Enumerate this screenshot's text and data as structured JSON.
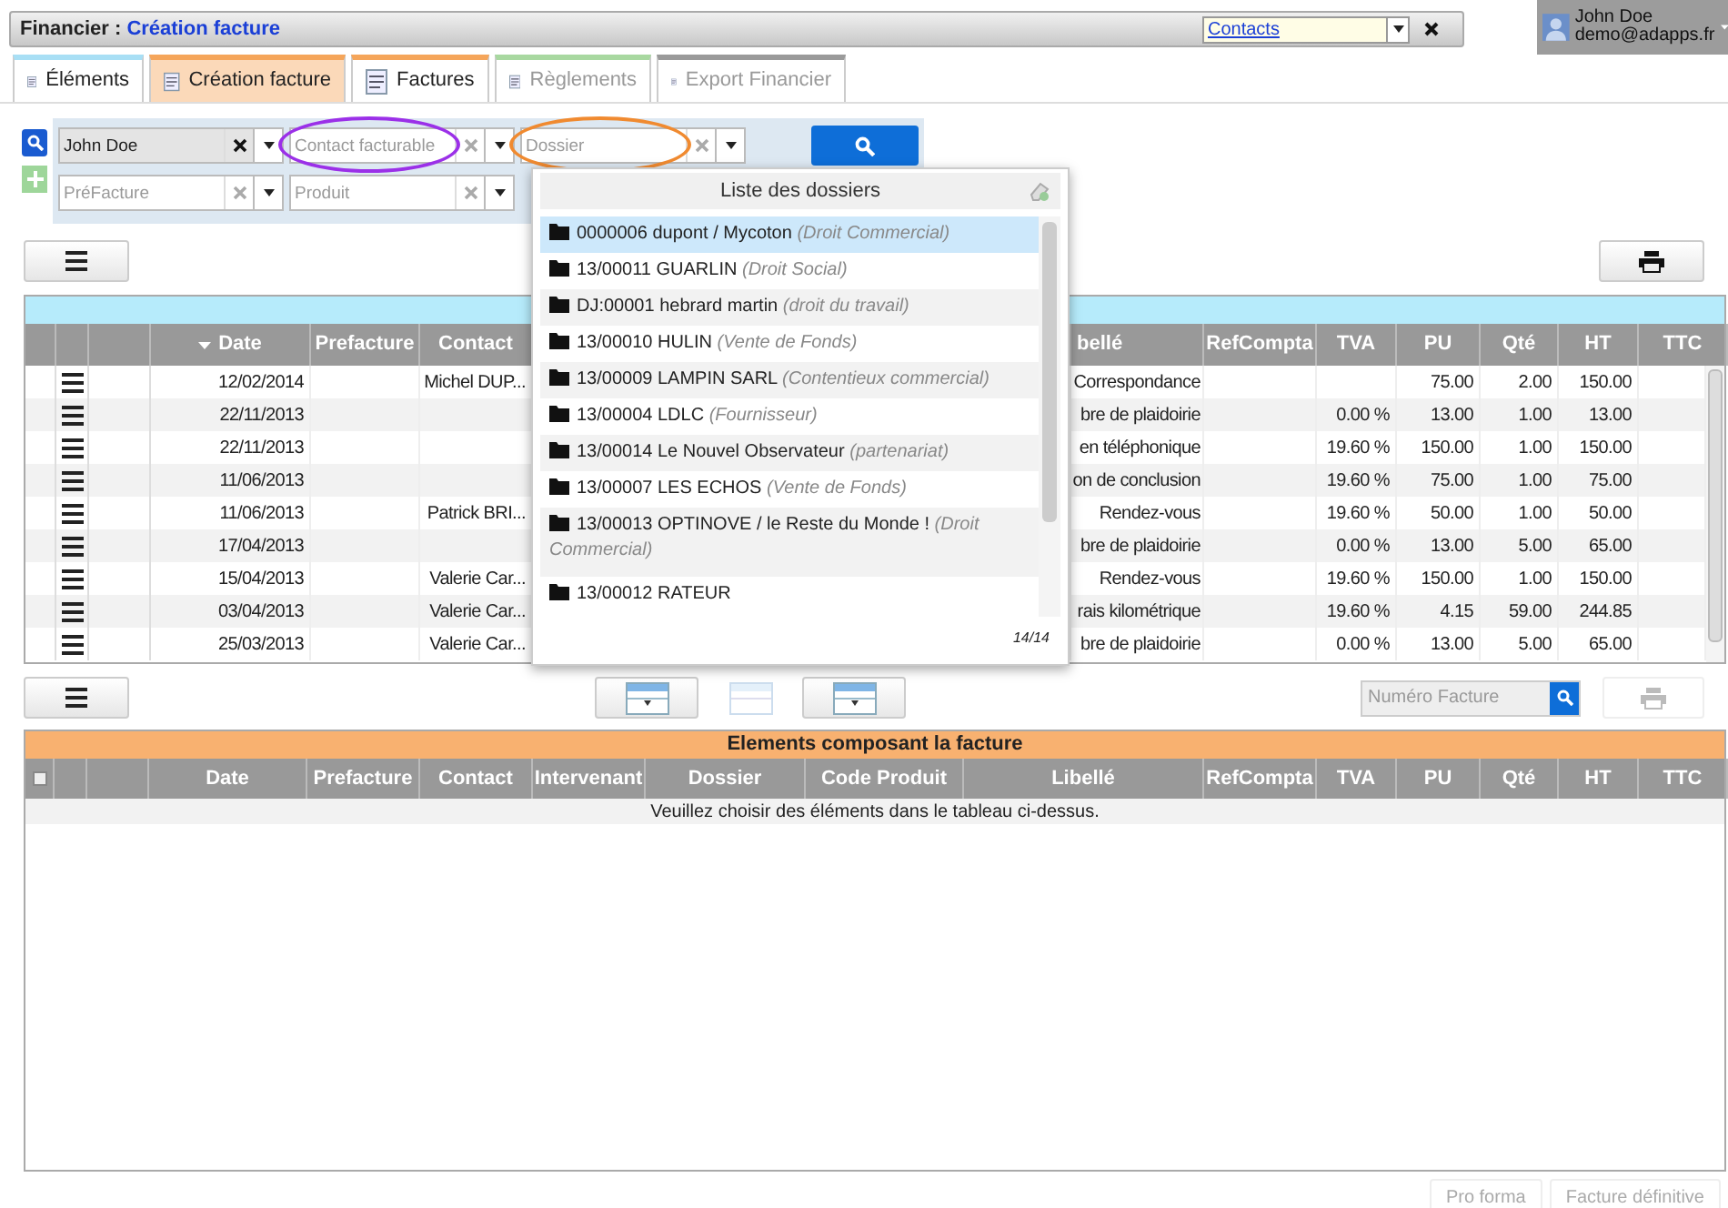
{
  "header": {
    "section": "Financier :",
    "page": "Création facture",
    "contacts_select": {
      "value": "Contacts"
    },
    "user": {
      "name": "John Doe",
      "email": "demo@adapps.fr"
    }
  },
  "tabs": [
    {
      "label": "Éléments",
      "selected": false,
      "disabled": false,
      "color": "#a8dff5"
    },
    {
      "label": "Création facture",
      "selected": true,
      "disabled": false,
      "color": "#f5a55a"
    },
    {
      "label": "Factures",
      "selected": false,
      "disabled": false,
      "color": "#f5a55a"
    },
    {
      "label": "Règlements",
      "selected": false,
      "disabled": true,
      "color": "#a8d8a0"
    },
    {
      "label": "Export Financier",
      "selected": false,
      "disabled": true,
      "color": "#9a9a9a"
    }
  ],
  "filters": [
    [
      {
        "value": "John Doe"
      },
      {
        "placeholder": "Contact facturable",
        "color": "#9b30e8"
      },
      {
        "placeholder": "Dossier",
        "color": "#f08a30"
      }
    ],
    [
      {
        "placeholder": "PréFacture"
      },
      {
        "placeholder": "Produit"
      }
    ]
  ],
  "dossier_list": {
    "title": "Liste des dossiers",
    "count": "14/14",
    "items": [
      {
        "name": "0000006 dupont / Mycoton",
        "category": "(Droit Commercial)",
        "selected": true
      },
      {
        "name": "13/00011 GUARLIN",
        "category": "(Droit Social)",
        "selected": false
      },
      {
        "name": "DJ:00001 hebrard martin",
        "category": "(droit du travail)",
        "selected": false
      },
      {
        "name": "13/00010 HULIN",
        "category": "(Vente de Fonds)",
        "selected": false
      },
      {
        "name": "13/00009 LAMPIN SARL",
        "category": "(Contentieux commercial)",
        "selected": false
      },
      {
        "name": "13/00004 LDLC",
        "category": "(Fournisseur)",
        "selected": false
      },
      {
        "name": "13/00014 Le Nouvel Observateur",
        "category": "(partenariat)",
        "selected": false
      },
      {
        "name": "13/00007 LES ECHOS",
        "category": "(Vente de Fonds)",
        "selected": false
      },
      {
        "name": "13/00013 OPTINOVE / le Reste du Monde !",
        "category": "(Droit Commercial)",
        "selected": false
      },
      {
        "name": "13/00012 RATEUR",
        "selected": false
      }
    ]
  },
  "elements_table": {
    "columns": [
      {
        "label": "Date",
        "sorted": true
      },
      {
        "label": "Prefacture",
        "sorted": false
      },
      {
        "label": "Contact",
        "sorted": false
      },
      {
        "label": "bellé",
        "sorted": false
      },
      {
        "label": "RefCompta",
        "sorted": false
      },
      {
        "label": "TVA",
        "sorted": false
      },
      {
        "label": "PU",
        "sorted": false
      },
      {
        "label": "Qté",
        "sorted": false
      },
      {
        "label": "HT",
        "sorted": false
      },
      {
        "label": "TTC",
        "sorted": false
      }
    ],
    "rows": [
      {
        "date": "12/02/2014",
        "contact": "Michel DUP...",
        "libelle": "Correspondance",
        "pu": "75.00",
        "qte": "2.00",
        "ht": "150.00"
      },
      {
        "date": "22/11/2013",
        "libelle": "bre de plaidoirie",
        "tva": "0.00 %",
        "pu": "13.00",
        "qte": "1.00",
        "ht": "13.00"
      },
      {
        "date": "22/11/2013",
        "libelle": "en téléphonique",
        "tva": "19.60 %",
        "pu": "150.00",
        "qte": "1.00",
        "ht": "150.00"
      },
      {
        "date": "11/06/2013",
        "libelle": "on de conclusion",
        "tva": "19.60 %",
        "pu": "75.00",
        "qte": "1.00",
        "ht": "75.00"
      },
      {
        "date": "11/06/2013",
        "contact": "Patrick BRI...",
        "libelle": "Rendez-vous",
        "tva": "19.60 %",
        "pu": "50.00",
        "qte": "1.00",
        "ht": "50.00"
      },
      {
        "date": "17/04/2013",
        "libelle": "bre de plaidoirie",
        "tva": "0.00 %",
        "pu": "13.00",
        "qte": "5.00",
        "ht": "65.00"
      },
      {
        "date": "15/04/2013",
        "contact": "Valerie Car...",
        "libelle": "Rendez-vous",
        "tva": "19.60 %",
        "pu": "150.00",
        "qte": "1.00",
        "ht": "150.00"
      },
      {
        "date": "03/04/2013",
        "contact": "Valerie Car...",
        "libelle": "rais kilométrique",
        "tva": "19.60 %",
        "pu": "4.15",
        "qte": "59.00",
        "ht": "244.85"
      },
      {
        "date": "25/03/2013",
        "contact": "Valerie Car...",
        "libelle": "bre de plaidoirie",
        "tva": "0.00 %",
        "pu": "13.00",
        "qte": "5.00",
        "ht": "65.00"
      }
    ]
  },
  "view_toggles": [
    {
      "selected": false
    },
    {
      "selected": true
    },
    {
      "selected": false
    }
  ],
  "invoice_search": {
    "placeholder": "Numéro Facture"
  },
  "composition_table": {
    "title": "Elements composant la facture",
    "select_all": {
      "checked": false
    },
    "columns": [
      "Date",
      "Prefacture",
      "Contact",
      "Intervenant",
      "Dossier",
      "Code Produit",
      "Libellé",
      "RefCompta",
      "TVA",
      "PU",
      "Qté",
      "HT",
      "TTC"
    ],
    "empty_message": "Veuillez choisir des éléments dans le tableau ci-dessus."
  },
  "buttons": [
    {
      "label": "Pro forma",
      "disabled": true
    },
    {
      "label": "Facture définitive",
      "disabled": true
    }
  ]
}
